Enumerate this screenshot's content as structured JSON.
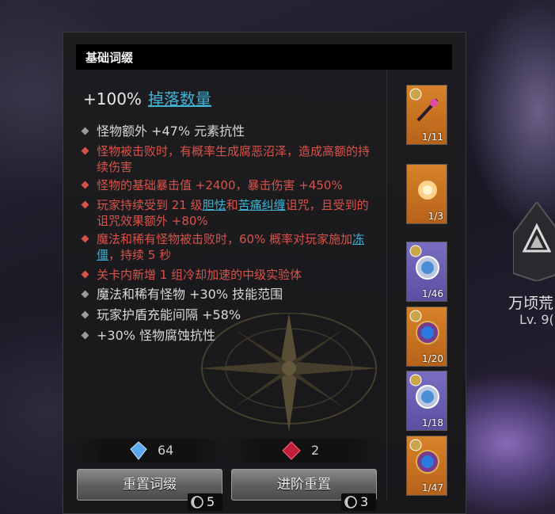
{
  "panel": {
    "title": "基础词缀"
  },
  "main_affix": {
    "value": "+100%",
    "keyword": "掉落数量"
  },
  "affixes": [
    {
      "color": "white",
      "text": "怪物额外 +47% 元素抗性"
    },
    {
      "color": "red",
      "text": "怪物被击败时，有概率生成腐恶沼泽，造成高额的持续伤害"
    },
    {
      "color": "red",
      "text": "怪物的基础暴击值 +2400，暴击伤害 +450%"
    },
    {
      "color": "red",
      "p1": "玩家持续受到 21 级",
      "kw1": "胆怯",
      "p2": "和",
      "kw2": "苦痛纠缠",
      "p3": "诅咒，且受到的诅咒效果额外 +80%"
    },
    {
      "color": "red",
      "p1": "魔法和稀有怪物被击败时，60% 概率对玩家施加",
      "kw1": "冻僵",
      "p2": "，持续 5 秒"
    },
    {
      "color": "red",
      "text": "关卡内新增 1 组冷却加速的中级实验体"
    },
    {
      "color": "white",
      "text": "魔法和稀有怪物 +30% 技能范围"
    },
    {
      "color": "white",
      "text": "玩家护盾充能间隔 +58%"
    },
    {
      "color": "white",
      "text": "+30% 怪物腐蚀抗性"
    }
  ],
  "slots": [
    {
      "count": "1/11",
      "rarity": "orange",
      "icon": "dagger-icon"
    },
    {
      "count": "1/3",
      "rarity": "orange",
      "icon": "flame-orb-icon"
    },
    {
      "count": "1/46",
      "rarity": "purple",
      "icon": "compass-icon"
    },
    {
      "count": "1/20",
      "rarity": "orange",
      "icon": "compass-icon"
    },
    {
      "count": "1/18",
      "rarity": "purple",
      "icon": "compass-icon"
    },
    {
      "count": "1/47",
      "rarity": "orange",
      "icon": "compass-icon"
    }
  ],
  "currency": {
    "blue": "64",
    "red": "2"
  },
  "buttons": {
    "reset": {
      "label": "重置词缀",
      "cost": "5"
    },
    "advanced": {
      "label": "进阶重置",
      "cost": "3"
    }
  },
  "map": {
    "name": "万顷荒",
    "level": "Lv. 9("
  },
  "colors": {
    "red_affix": "#d9524a",
    "keyword": "#3fb2d6",
    "orange_slot": "#d8822a",
    "purple_slot": "#7a6ec0"
  }
}
